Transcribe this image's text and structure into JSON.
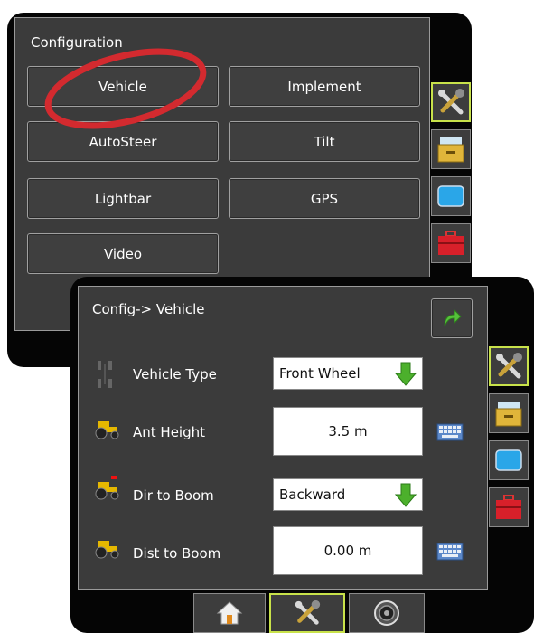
{
  "config_screen": {
    "title": "Configuration",
    "buttons": [
      "Vehicle",
      "Implement",
      "AutoSteer",
      "Tilt",
      "Lightbar",
      "GPS",
      "Video"
    ]
  },
  "vehicle_screen": {
    "title": "Config-> Vehicle",
    "vehicle_type": {
      "label": "Vehicle Type",
      "value": "Front Wheel"
    },
    "ant_height": {
      "label": "Ant Height",
      "value": "3.5 m"
    },
    "dir_to_boom": {
      "label": "Dir to Boom",
      "value": "Backward"
    },
    "dist_to_boom": {
      "label": "Dist to Boom",
      "value": "0.00 m"
    }
  },
  "colors": {
    "highlight_ring": "#d32a2f",
    "active_tab_border": "#c8e24a",
    "arrow_green": "#4cb02c"
  },
  "icons": [
    "tools-icon",
    "drawer-icon",
    "screen-icon",
    "toolbox-icon",
    "home-icon",
    "share-arrow-icon",
    "keyboard-icon",
    "down-arrow-icon",
    "gauge-icon"
  ]
}
